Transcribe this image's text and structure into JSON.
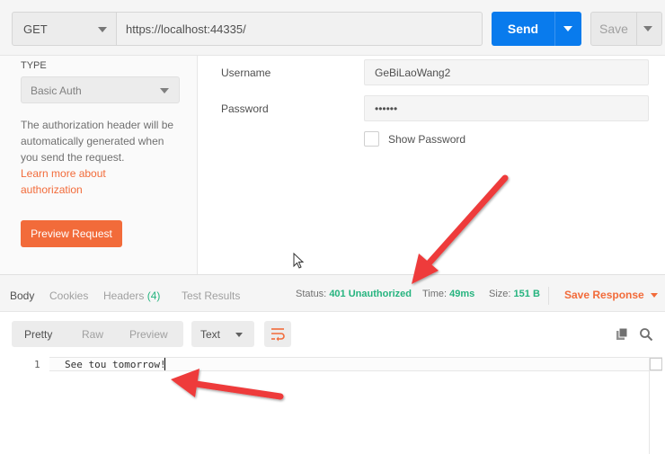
{
  "request": {
    "method": "GET",
    "url": "https://localhost:44335/",
    "send_label": "Send",
    "save_label": "Save"
  },
  "auth": {
    "type_label": "TYPE",
    "type_value": "Basic Auth",
    "description": "The authorization header will be automatically generated when you send the request.",
    "learn_more": "Learn more about authorization",
    "preview_button": "Preview Request",
    "username_label": "Username",
    "username_value": "GeBiLaoWang2",
    "password_label": "Password",
    "password_value": "••••••",
    "show_password": "Show Password"
  },
  "response": {
    "tabs": [
      {
        "label": "Body"
      },
      {
        "label": "Cookies"
      },
      {
        "label": "Headers",
        "count": "(4)"
      },
      {
        "label": "Test Results"
      }
    ],
    "status_label": "Status:",
    "status_value": "401 Unauthorized",
    "time_label": "Time:",
    "time_value": "49ms",
    "size_label": "Size:",
    "size_value": "151 B",
    "save_response": "Save Response",
    "formats": [
      "Pretty",
      "Raw",
      "Preview"
    ],
    "language": "Text",
    "lines": [
      {
        "num": "1",
        "text": "See tou tomorrow!"
      }
    ]
  },
  "colors": {
    "accent_blue": "#097bed",
    "accent_orange": "#f26b3a",
    "status_green": "#26b47f",
    "annotation_red": "#ee3b3b"
  },
  "icons": [
    "caret-down-icon",
    "wrap-lines-icon",
    "copy-icon",
    "search-icon",
    "mouse-pointer-icon",
    "annotation-arrow-icon"
  ]
}
